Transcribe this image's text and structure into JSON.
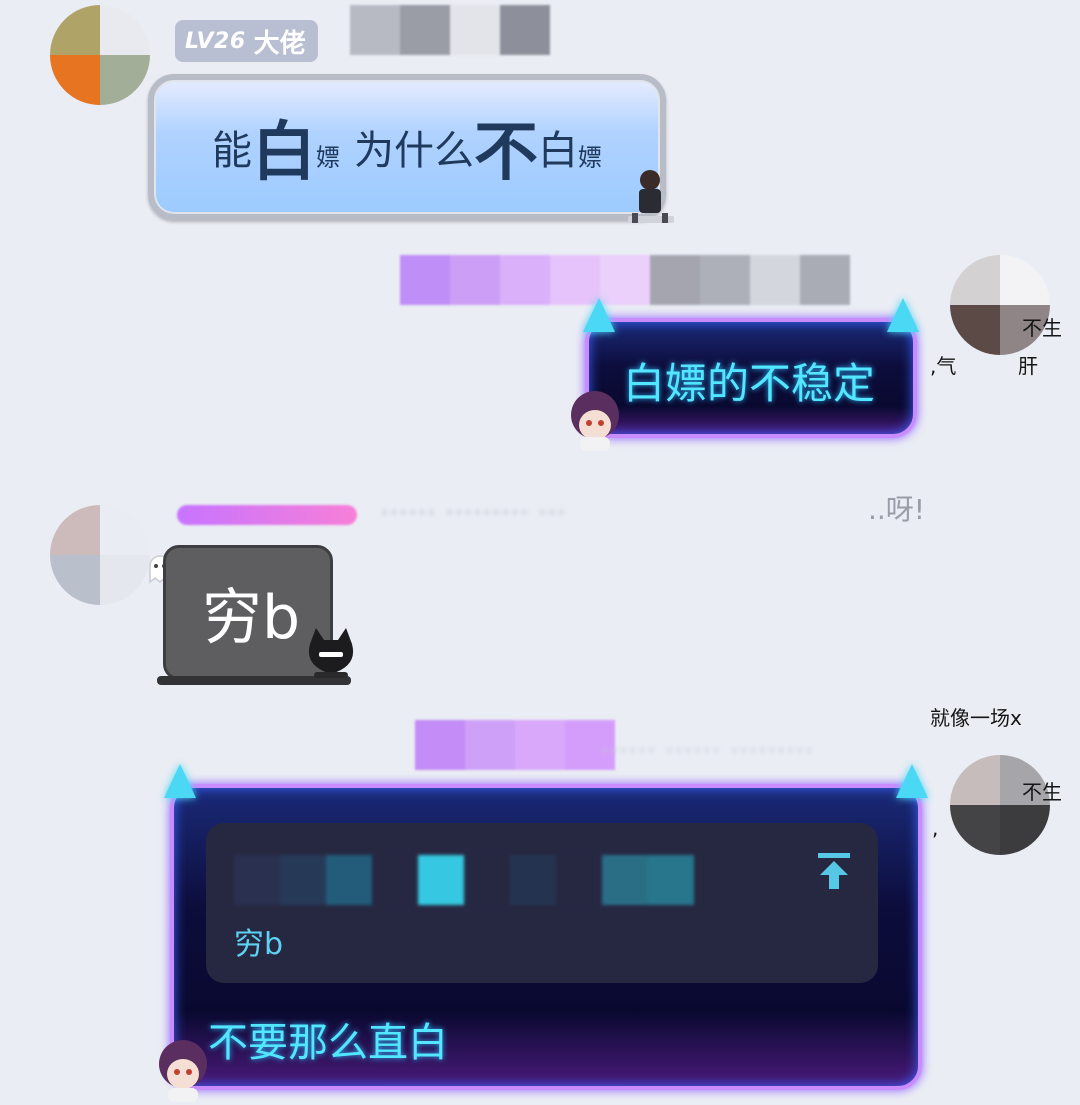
{
  "messages": {
    "msg1": {
      "level_badge": "LV26",
      "title_badge": "大佬",
      "bubble": {
        "w1": "能",
        "w2": "白",
        "w3": "嫖",
        "w4": "为什么",
        "w5": "不",
        "w6": "白",
        "w7": "嫖"
      }
    },
    "msg2": {
      "bubble_text": "白嫖的不稳定"
    },
    "msg3": {
      "name_suffix": "..呀!",
      "bubble_text": "穷b"
    },
    "msg4": {
      "quote_text": "穷b",
      "reply_text": "不要那么直白"
    }
  },
  "side_snippets": {
    "s1": "不生",
    "s2": ",气",
    "s3": "肝",
    "s4": "就像一场x",
    "s5": "不生",
    "s6": ","
  },
  "colors": {
    "background": "#eaedf4",
    "neon_text": "#52e6ff",
    "neon_border": "#c98cff",
    "quote_bg": "#262842",
    "level_badge_bg": "#b9bfd2"
  },
  "icons": {
    "quote_jump": "arrow-to-top-icon"
  }
}
